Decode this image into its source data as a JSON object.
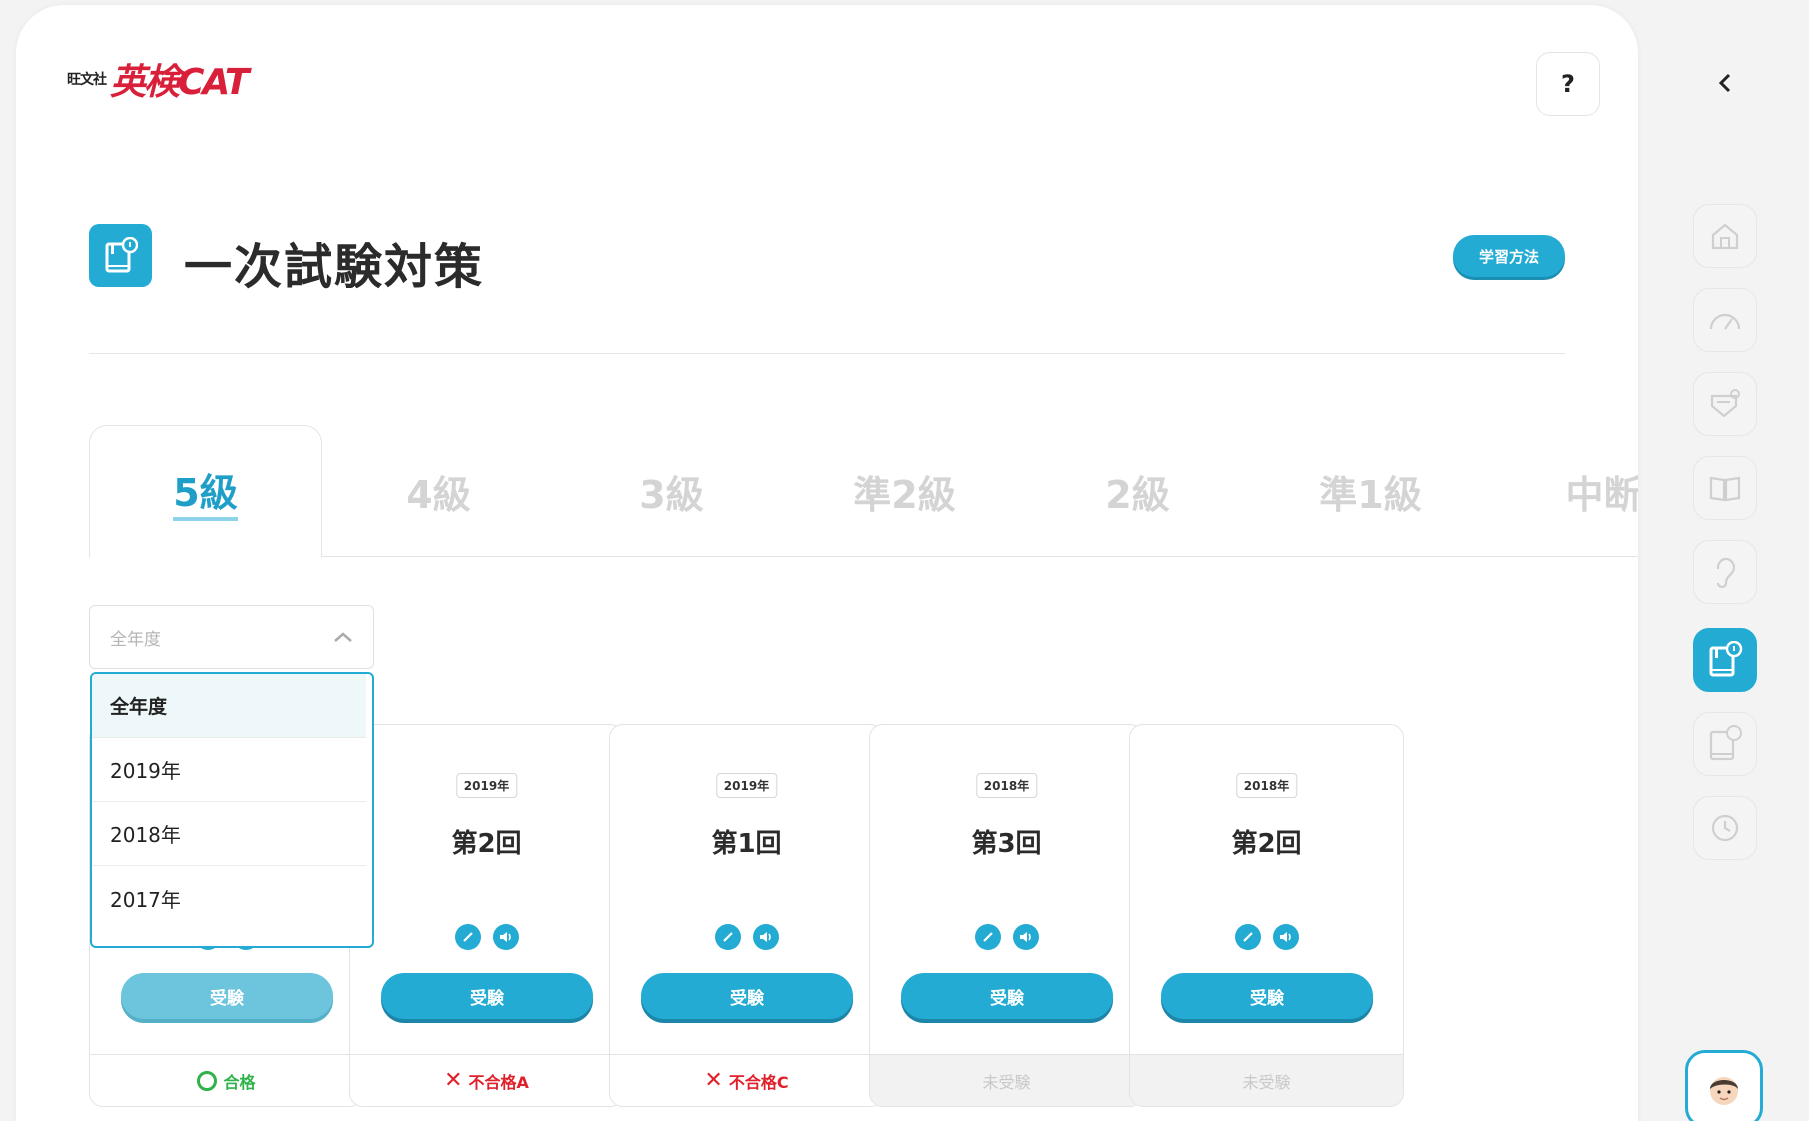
{
  "logo": {
    "publisher": "旺文社",
    "brand": "英検CAT"
  },
  "help_label": "?",
  "page": {
    "title": "一次試験対策",
    "method_label": "学習方法"
  },
  "tabs": [
    "5級",
    "4級",
    "3級",
    "準2級",
    "2級",
    "準1級",
    "中断"
  ],
  "active_tab": "5級",
  "year_select": {
    "placeholder": "全年度",
    "options": [
      "全年度",
      "2019年",
      "2018年",
      "2017年"
    ],
    "selected": "全年度"
  },
  "cards": [
    {
      "year": "2019年",
      "round": "第2回",
      "button": "受験",
      "result": "不合格A",
      "status": "fail"
    },
    {
      "year": "2019年",
      "round": "第1回",
      "button": "受験",
      "result": "不合格C",
      "status": "fail"
    },
    {
      "year": "2018年",
      "round": "第3回",
      "button": "受験",
      "result": "未受験",
      "status": "none"
    },
    {
      "year": "2018年",
      "round": "第2回",
      "button": "受験",
      "result": "未受験",
      "status": "none"
    }
  ],
  "hidden_card": {
    "button": "受験",
    "result": "合格",
    "status": "pass"
  },
  "colors": {
    "accent": "#23abd3",
    "brand_red": "#d8203a",
    "pass": "#2fb24a",
    "fail": "#e0202a"
  },
  "sidebar": {
    "items": [
      "home-icon",
      "gauge-icon",
      "test-icon",
      "book-icon",
      "ear-icon",
      "exam-book-icon",
      "exam-book-2-icon",
      "history-icon"
    ],
    "active": "exam-book-icon"
  }
}
